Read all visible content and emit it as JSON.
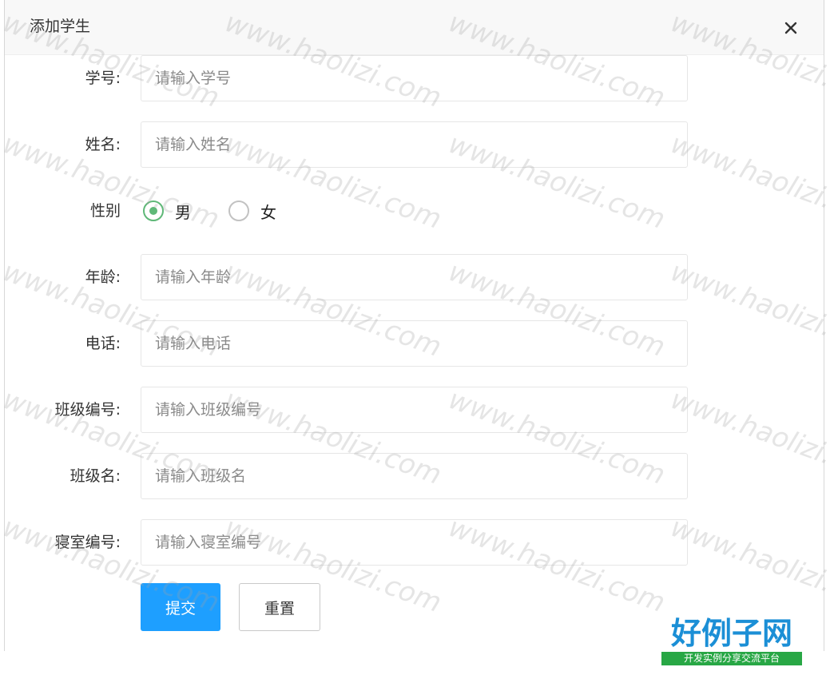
{
  "dialog": {
    "title": "添加学生",
    "close_symbol": "close-icon"
  },
  "form": {
    "student_no": {
      "label": "学号:",
      "placeholder": "请输入学号",
      "value": ""
    },
    "name": {
      "label": "姓名:",
      "placeholder": "请输入姓名",
      "value": ""
    },
    "gender": {
      "label": "性别",
      "options": [
        {
          "label": "男",
          "selected": true
        },
        {
          "label": "女",
          "selected": false
        }
      ]
    },
    "age": {
      "label": "年龄:",
      "placeholder": "请输入年龄",
      "value": ""
    },
    "phone": {
      "label": "电话:",
      "placeholder": "请输入电话",
      "value": ""
    },
    "class_no": {
      "label": "班级编号:",
      "placeholder": "请输入班级编号",
      "value": ""
    },
    "class_name": {
      "label": "班级名:",
      "placeholder": "请输入班级名",
      "value": ""
    },
    "dorm_no": {
      "label": "寝室编号:",
      "placeholder": "请输入寝室编号",
      "value": ""
    }
  },
  "buttons": {
    "submit": "提交",
    "reset": "重置"
  },
  "colors": {
    "primary": "#1E9FFF",
    "radio_checked": "#5FB878",
    "logo_blue": "#1b8fd6",
    "logo_green": "#28a745"
  },
  "watermark": {
    "text": "www.haolizi.com"
  },
  "logo": {
    "main": "好例子网",
    "sub": "开发实例分享交流平台"
  }
}
